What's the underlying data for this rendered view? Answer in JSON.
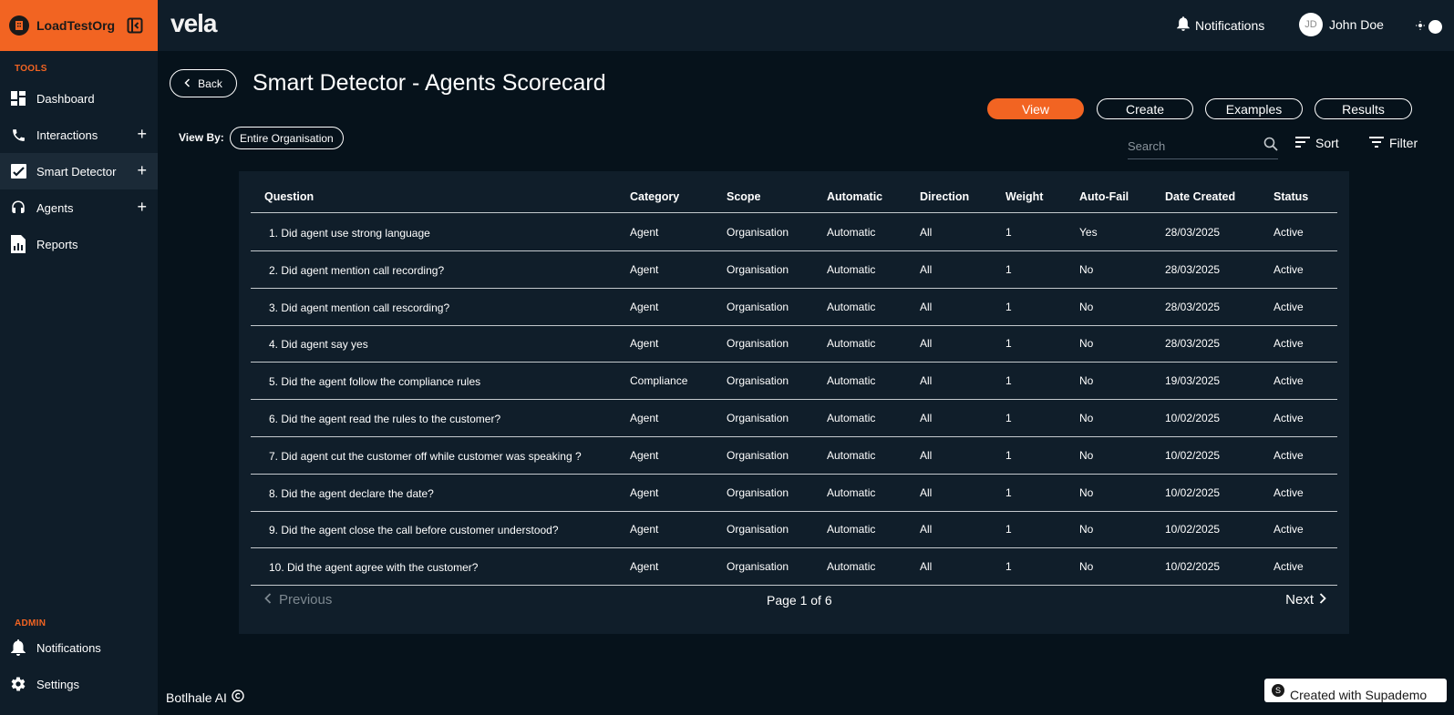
{
  "org": {
    "name": "LoadTestOrg"
  },
  "sidebar": {
    "tools_label": "TOOLS",
    "items": [
      {
        "label": "Dashboard",
        "icon": "dashboard-icon"
      },
      {
        "label": "Interactions",
        "icon": "phone-icon",
        "expandable": true
      },
      {
        "label": "Smart Detector",
        "icon": "chart-check-icon",
        "expandable": true,
        "active": true
      },
      {
        "label": "Agents",
        "icon": "headset-icon",
        "expandable": true
      },
      {
        "label": "Reports",
        "icon": "report-icon"
      }
    ],
    "admin_label": "ADMIN",
    "admin_items": [
      {
        "label": "Notifications",
        "icon": "bell-icon"
      },
      {
        "label": "Settings",
        "icon": "gear-icon"
      }
    ]
  },
  "topbar": {
    "brand": "vela",
    "notifications_label": "Notifications",
    "user_initials": "JD",
    "user_name": "John Doe"
  },
  "page": {
    "back_label": "Back",
    "title": "Smart Detector - Agents Scorecard",
    "view_by_label": "View By:",
    "view_by_value": "Entire Organisation",
    "tabs": [
      "View",
      "Create",
      "Examples",
      "Results"
    ],
    "active_tab": "View",
    "search_placeholder": "Search",
    "sort_label": "Sort",
    "filter_label": "Filter"
  },
  "table": {
    "columns": [
      "Question",
      "Category",
      "Scope",
      "Automatic",
      "Direction",
      "Weight",
      "Auto-Fail",
      "Date Created",
      "Status"
    ],
    "rows": [
      [
        "1.  Did agent use strong language",
        "Agent",
        "Organisation",
        "Automatic",
        "All",
        "1",
        "Yes",
        "28/03/2025",
        "Active"
      ],
      [
        "2.  Did agent mention call recording?",
        "Agent",
        "Organisation",
        "Automatic",
        "All",
        "1",
        "No",
        "28/03/2025",
        "Active"
      ],
      [
        "3.  Did agent mention call rescording?",
        "Agent",
        "Organisation",
        "Automatic",
        "All",
        "1",
        "No",
        "28/03/2025",
        "Active"
      ],
      [
        "4.  Did agent say yes",
        "Agent",
        "Organisation",
        "Automatic",
        "All",
        "1",
        "No",
        "28/03/2025",
        "Active"
      ],
      [
        "5.  Did the agent follow the compliance rules",
        "Compliance",
        "Organisation",
        "Automatic",
        "All",
        "1",
        "No",
        "19/03/2025",
        "Active"
      ],
      [
        "6.  Did the agent read the rules to the customer?",
        "Agent",
        "Organisation",
        "Automatic",
        "All",
        "1",
        "No",
        "10/02/2025",
        "Active"
      ],
      [
        "7.  Did agent cut the customer off while customer was speaking ?",
        "Agent",
        "Organisation",
        "Automatic",
        "All",
        "1",
        "No",
        "10/02/2025",
        "Active"
      ],
      [
        "8.  Did the agent declare the date?",
        "Agent",
        "Organisation",
        "Automatic",
        "All",
        "1",
        "No",
        "10/02/2025",
        "Active"
      ],
      [
        "9.  Did the agent close the call before customer understood?",
        "Agent",
        "Organisation",
        "Automatic",
        "All",
        "1",
        "No",
        "10/02/2025",
        "Active"
      ],
      [
        "10.  Did the agent agree with the customer?",
        "Agent",
        "Organisation",
        "Automatic",
        "All",
        "1",
        "No",
        "10/02/2025",
        "Active"
      ]
    ]
  },
  "pager": {
    "previous_label": "Previous",
    "page_info": "Page 1 of 6",
    "next_label": "Next"
  },
  "footer": {
    "text": "Botlhale AI"
  },
  "badge": {
    "text": "Created with Supademo"
  },
  "colors": {
    "accent": "#f26422",
    "background": "#06121b",
    "panel": "#0f1d29"
  }
}
